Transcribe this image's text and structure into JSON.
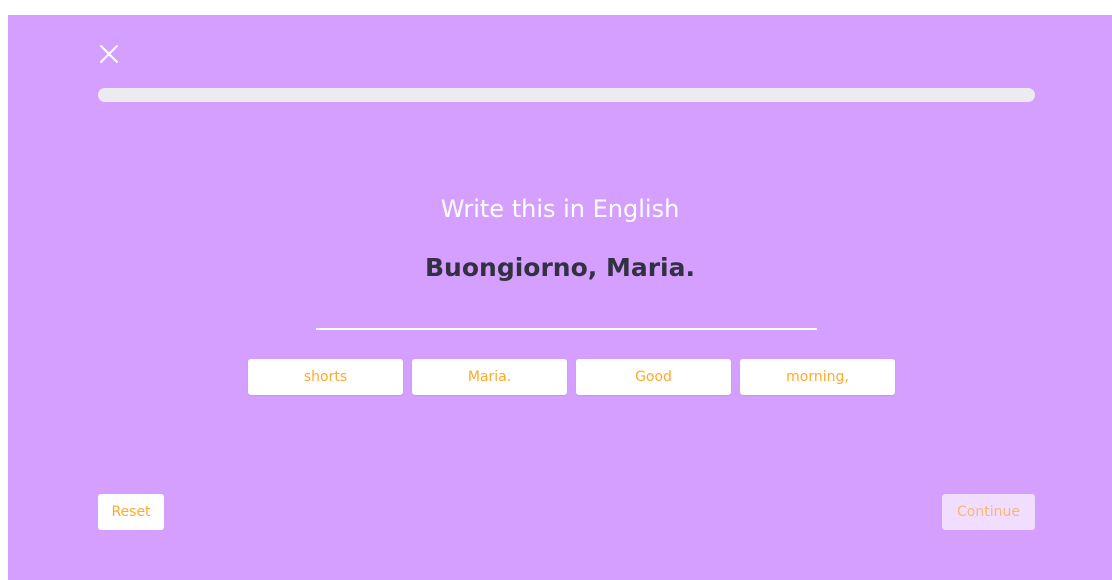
{
  "header": {
    "close_icon": "close-icon",
    "progress": 0
  },
  "exercise": {
    "instruction": "Write this in English",
    "prompt": "Buongiorno, Maria."
  },
  "word_bank": [
    "shorts",
    "Maria.",
    "Good",
    "morning,"
  ],
  "footer": {
    "reset_label": "Reset",
    "continue_label": "Continue",
    "continue_enabled": false
  },
  "colors": {
    "background": "#d59fff",
    "accent": "#ffa927",
    "prompt_text": "#333041",
    "track": "#ececf0"
  }
}
